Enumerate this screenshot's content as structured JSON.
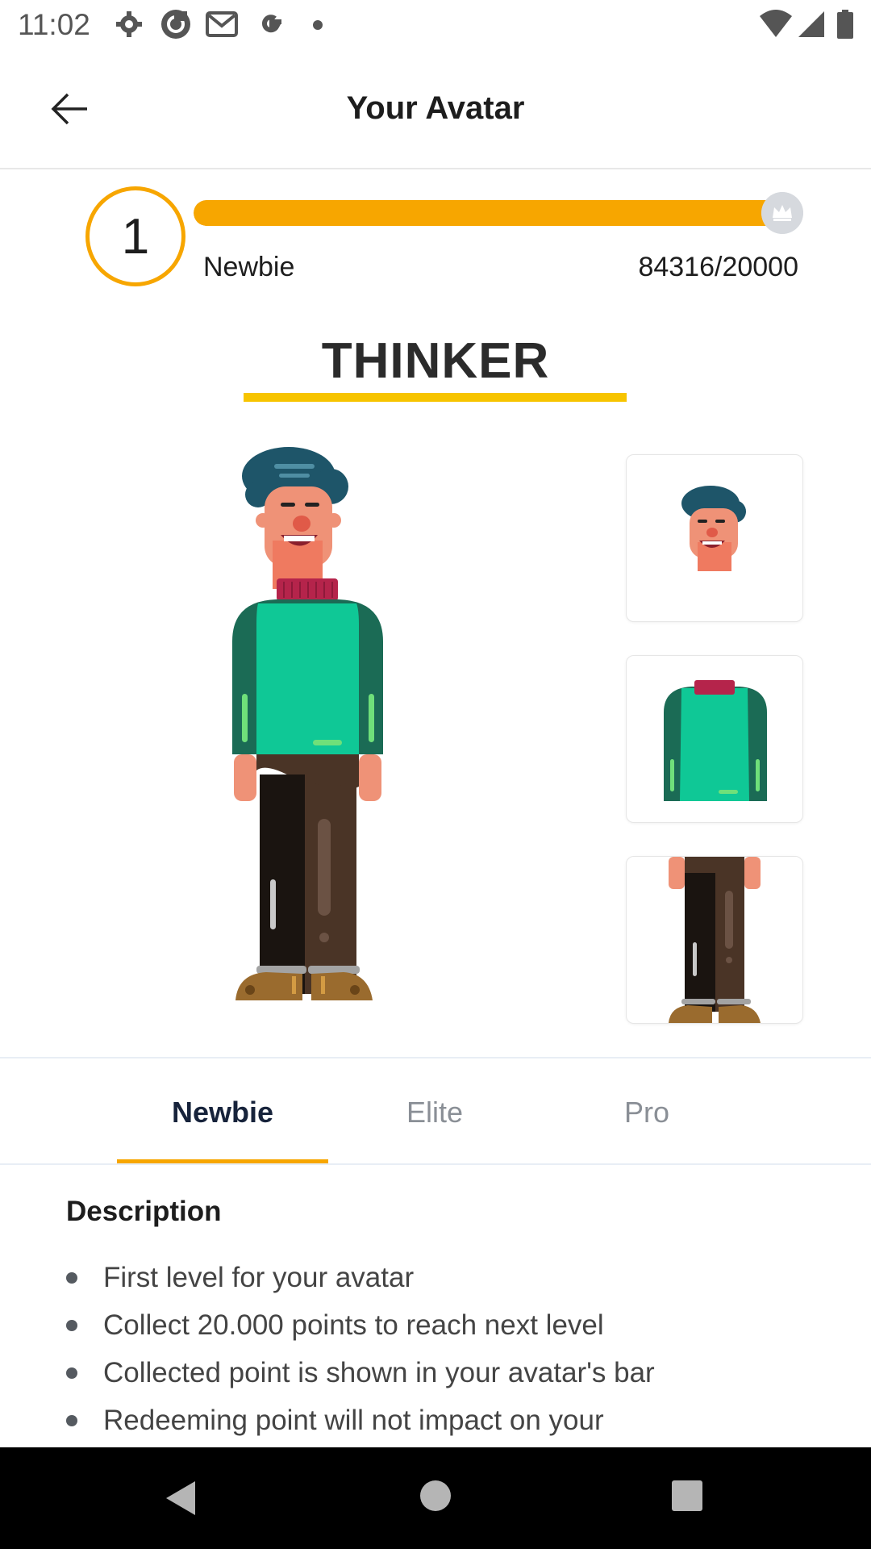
{
  "status_bar": {
    "time": "11:02",
    "icons": [
      "settings-icon",
      "sync-icon",
      "gmail-icon",
      "google-icon",
      "dot-icon",
      "wifi-icon",
      "signal-icon",
      "battery-icon"
    ]
  },
  "app_bar": {
    "title": "Your Avatar",
    "back_icon": "arrow-left-icon"
  },
  "level": {
    "number": "1",
    "name": "Newbie",
    "points": "84316/20000",
    "progress_fraction": 1.0,
    "badge_icon": "crown-icon"
  },
  "avatar": {
    "name": "THINKER",
    "parts": [
      "head",
      "torso",
      "legs"
    ]
  },
  "tabs": [
    {
      "label": "Newbie",
      "active": true
    },
    {
      "label": "Elite",
      "active": false
    },
    {
      "label": "Pro",
      "active": false
    }
  ],
  "description": {
    "title": "Description",
    "items": [
      "First level for your avatar",
      "Collect 20.000 points to reach next level",
      "Collected point is shown in your avatar's bar",
      "Redeeming point will not impact on your"
    ]
  },
  "nav_bar": {
    "buttons": [
      "back-triangle-icon",
      "home-circle-icon",
      "recents-square-icon"
    ]
  },
  "colors": {
    "accent": "#f7a600",
    "underline": "#f7c400",
    "sweater": "#0fc896",
    "sleeves": "#1b6b55",
    "hair": "#1e5569",
    "skin": "#ef9277",
    "scarf": "#b5244b",
    "pants_dark": "#1a1410",
    "pants_brown": "#4a3426",
    "shoes": "#9a6b2e"
  }
}
